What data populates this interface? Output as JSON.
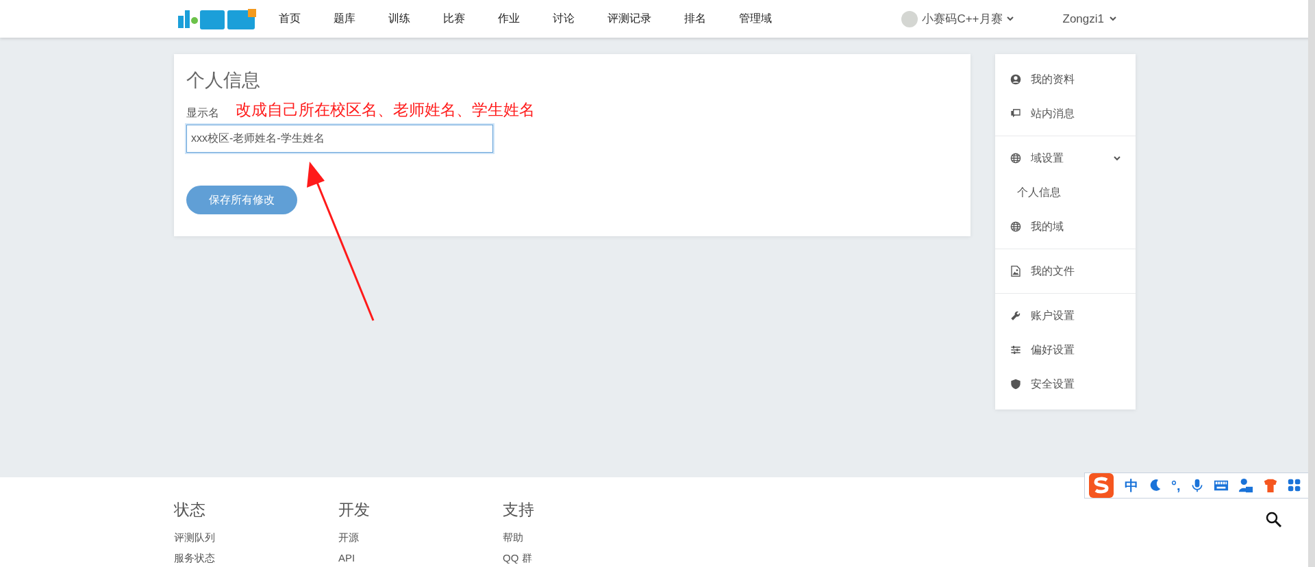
{
  "header": {
    "nav": [
      {
        "label": "首页"
      },
      {
        "label": "题库"
      },
      {
        "label": "训练"
      },
      {
        "label": "比赛"
      },
      {
        "label": "作业"
      },
      {
        "label": "讨论"
      },
      {
        "label": "评测记录"
      },
      {
        "label": "排名"
      },
      {
        "label": "管理域"
      }
    ],
    "domain": "小赛码C++月赛",
    "user": "Zongzi1"
  },
  "form": {
    "title": "个人信息",
    "field_label": "显示名",
    "annotation": "改成自己所在校区名、老师姓名、学生姓名",
    "field_value": "xxx校区-老师姓名-学生姓名",
    "save_button": "保存所有修改"
  },
  "sidebar": {
    "groups": [
      {
        "items": [
          {
            "label": "我的资料"
          },
          {
            "label": "站内消息"
          }
        ]
      },
      {
        "items": [
          {
            "label": "域设置",
            "expanded": true,
            "children": [
              {
                "label": "个人信息"
              }
            ]
          },
          {
            "label": "我的域"
          }
        ]
      },
      {
        "items": [
          {
            "label": "我的文件"
          }
        ]
      },
      {
        "items": [
          {
            "label": "账户设置"
          },
          {
            "label": "偏好设置"
          },
          {
            "label": "安全设置"
          }
        ]
      }
    ]
  },
  "ime_toolbar": {
    "mode": "中",
    "punctuation": "°,"
  },
  "footer": {
    "columns": [
      {
        "title": "状态",
        "links": [
          "评测队列",
          "服务状态"
        ]
      },
      {
        "title": "开发",
        "links": [
          "开源",
          "API"
        ]
      },
      {
        "title": "支持",
        "links": [
          "帮助",
          "QQ 群"
        ]
      }
    ]
  }
}
